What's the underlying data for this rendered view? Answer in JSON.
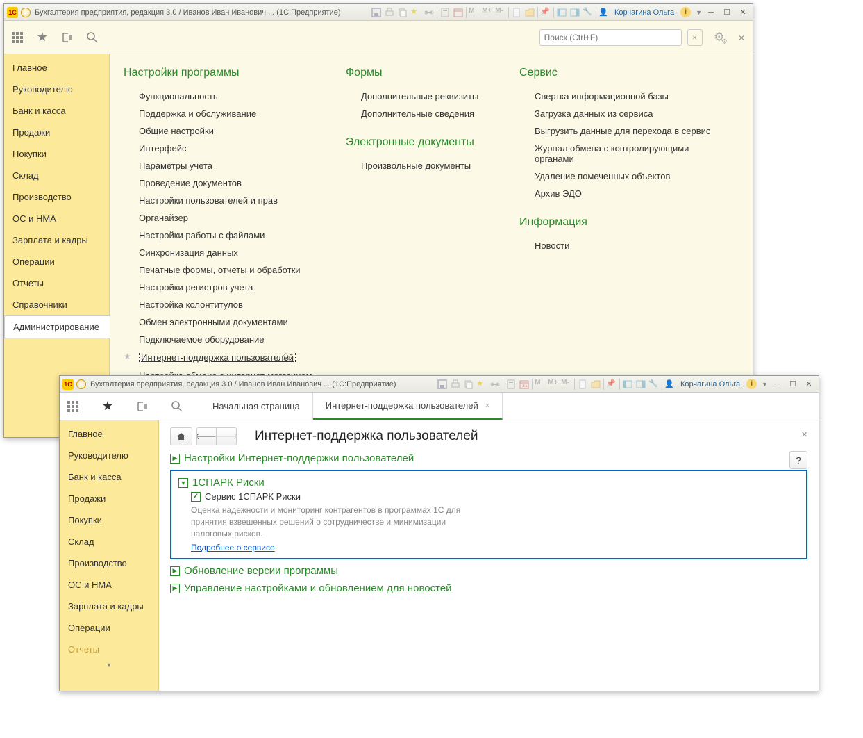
{
  "window1": {
    "title": "Бухгалтерия предприятия, редакция 3.0 / Иванов Иван Иванович ...  (1С:Предприятие)",
    "user": "Корчагина Ольга",
    "search_placeholder": "Поиск (Ctrl+F)"
  },
  "sidebar": {
    "items": [
      "Главное",
      "Руководителю",
      "Банк и касса",
      "Продажи",
      "Покупки",
      "Склад",
      "Производство",
      "ОС и НМА",
      "Зарплата и кадры",
      "Операции",
      "Отчеты",
      "Справочники",
      "Администрирование"
    ],
    "active_index": 12
  },
  "columns": {
    "col1": {
      "head": "Настройки программы",
      "items": [
        "Функциональность",
        "Поддержка и обслуживание",
        "Общие настройки",
        "Интерфейс",
        "Параметры учета",
        "Проведение документов",
        "Настройки пользователей и прав",
        "Органайзер",
        "Настройки работы с файлами",
        "Синхронизация данных",
        "Печатные формы, отчеты и обработки",
        "Настройки регистров учета",
        "Настройка колонтитулов",
        "Обмен электронными документами",
        "Подключаемое оборудование",
        "Интернет-поддержка пользователей",
        "Настройка обмена с интернет-магазином"
      ]
    },
    "col2a": {
      "head": "Формы",
      "items": [
        "Дополнительные реквизиты",
        "Дополнительные сведения"
      ]
    },
    "col2b": {
      "head": "Электронные документы",
      "items": [
        "Произвольные документы"
      ]
    },
    "col3a": {
      "head": "Сервис",
      "items": [
        "Свертка информационной базы",
        "Загрузка данных из сервиса",
        "Выгрузить данные для перехода в сервис",
        "Журнал обмена с контролирующими органами",
        "Удаление помеченных объектов",
        "Архив ЭДО"
      ]
    },
    "col3b": {
      "head": "Информация",
      "items": [
        "Новости"
      ]
    }
  },
  "window2": {
    "title": "Бухгалтерия предприятия, редакция 3.0 / Иванов Иван Иванович ...  (1С:Предприятие)",
    "user": "Корчагина Ольга",
    "tab1": "Начальная страница",
    "tab2": "Интернет-поддержка пользователей",
    "page_title": "Интернет-поддержка пользователей",
    "sections": {
      "s1": "Настройки Интернет-поддержки пользователей",
      "s2": {
        "title": "1СПАРК Риски",
        "checkbox": "Сервис 1СПАРК Риски",
        "desc": "Оценка надежности и мониторинг контрагентов в программах 1С для принятия взвешенных решений о сотрудничестве и минимизации налоговых рисков.",
        "link": "Подробнее о сервисе"
      },
      "s3": "Обновление версии программы",
      "s4": "Управление настройками и обновлением для новостей"
    }
  },
  "sidebar2": {
    "items": [
      "Главное",
      "Руководителю",
      "Банк и касса",
      "Продажи",
      "Покупки",
      "Склад",
      "Производство",
      "ОС и НМА",
      "Зарплата и кадры",
      "Операции",
      "Отчеты"
    ]
  }
}
